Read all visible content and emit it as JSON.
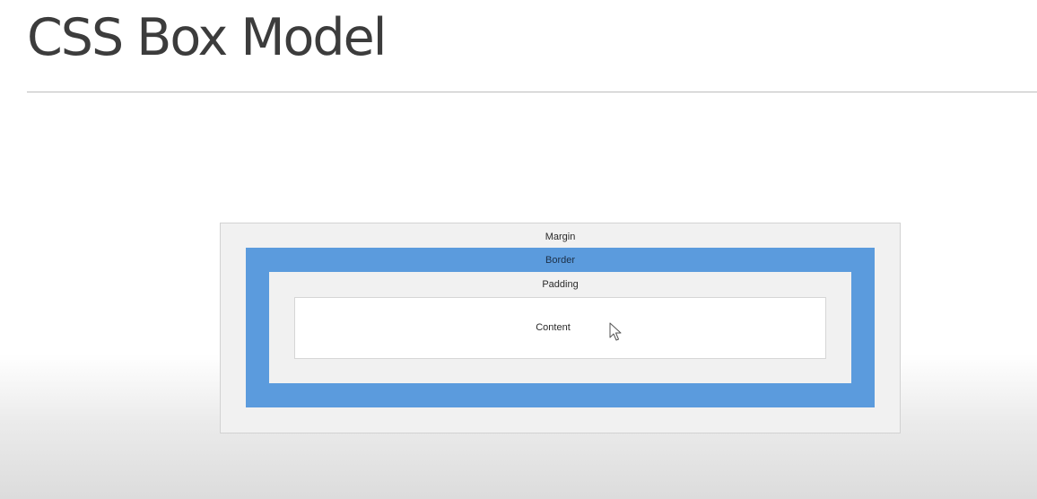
{
  "slide": {
    "title": "CSS Box Model"
  },
  "diagram": {
    "margin_label": "Margin",
    "border_label": "Border",
    "padding_label": "Padding",
    "content_label": "Content"
  },
  "colors": {
    "margin": "#f1f1f1",
    "border": "#5b9bdd",
    "padding": "#f1f1f1",
    "content": "#ffffff"
  },
  "icons": {
    "cursor": "mouse-pointer-icon"
  }
}
